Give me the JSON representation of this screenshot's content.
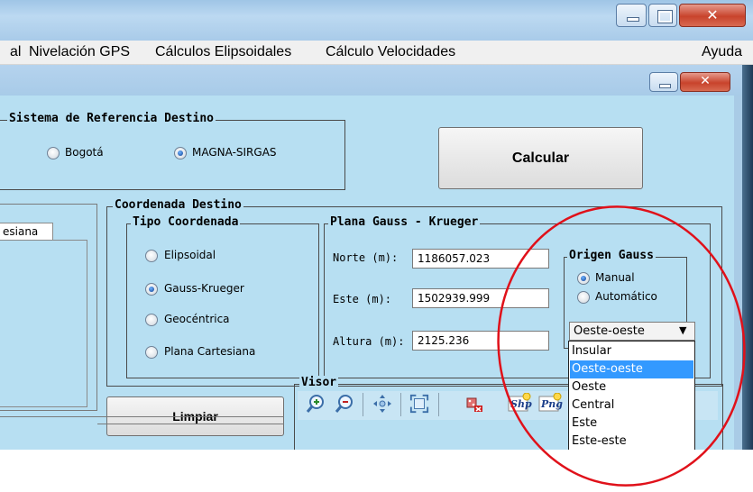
{
  "menu": {
    "items": [
      "al",
      "Nivelación GPS",
      "Cálculos Elipsoidales",
      "Cálculo Velocidades"
    ],
    "help": "Ayuda"
  },
  "ref_system": {
    "title": "Sistema de Referencia Destino",
    "options": [
      "Bogotá",
      "MAGNA-SIRGAS"
    ],
    "selected": "MAGNA-SIRGAS"
  },
  "calc_button": "Calcular",
  "coord_dest": {
    "title": "Coordenada Destino",
    "tab_partial": "esiana",
    "tipo": {
      "title": "Tipo Coordenada",
      "options": [
        "Elipsoidal",
        "Gauss-Krueger",
        "Geocéntrica",
        "Plana Cartesiana"
      ],
      "selected": "Gauss-Krueger"
    },
    "plana": {
      "title": "Plana Gauss - Krueger",
      "norte_label": "Norte (m):",
      "norte_value": "1186057.023",
      "este_label": "Este (m):",
      "este_value": "1502939.999",
      "altura_label": "Altura (m):",
      "altura_value": "2125.236"
    },
    "origen": {
      "title": "Origen Gauss",
      "options": [
        "Manual",
        "Automático"
      ],
      "selected": "Manual",
      "combo_value": "Oeste-oeste",
      "list": [
        "Insular",
        "Oeste-oeste",
        "Oeste",
        "Central",
        "Este",
        "Este-este"
      ],
      "highlighted": "Oeste-oeste"
    }
  },
  "clear_button": "Limpiar",
  "visor": {
    "title": "Visor",
    "tools": [
      "zoom-in-icon",
      "zoom-out-icon",
      "pan-icon",
      "zoom-extent-icon",
      "delete-layer-icon",
      "shp-icon",
      "png-icon"
    ],
    "shp_text": "Shp",
    "png_text": "Png"
  },
  "colors": {
    "form_bg": "#b7dff2",
    "highlight": "#3399ff",
    "annotation": "#e0111a"
  }
}
